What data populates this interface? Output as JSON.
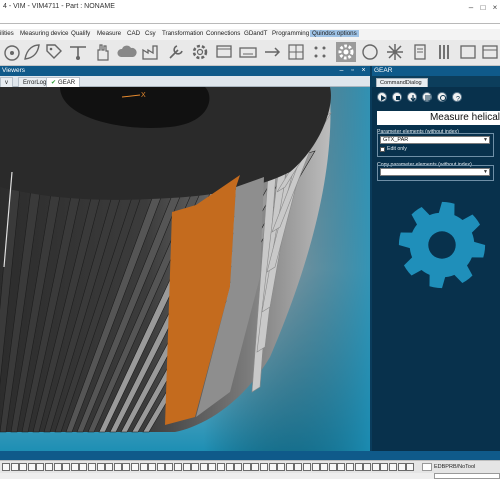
{
  "window": {
    "title": "4 - VIM - VIM4711 - Part : NONAME"
  },
  "menu": [
    {
      "label": "ilities",
      "active": false
    },
    {
      "label": "Measuring device",
      "active": false
    },
    {
      "label": "Qualify",
      "active": false
    },
    {
      "label": "Measure",
      "active": false
    },
    {
      "label": "CAD",
      "active": false
    },
    {
      "label": "Csy",
      "active": false
    },
    {
      "label": "Transformation",
      "active": false
    },
    {
      "label": "Connections",
      "active": false
    },
    {
      "label": "GDandT",
      "active": false
    },
    {
      "label": "Programming",
      "active": false
    },
    {
      "label": "Quindos options",
      "active": true
    }
  ],
  "viewer": {
    "header_label": "Viewers",
    "tabs": [
      {
        "label": "v",
        "active": false,
        "checked": false
      },
      {
        "label": "ErrorLog",
        "active": false,
        "checked": false
      },
      {
        "label": "GEAR",
        "active": true,
        "checked": true
      }
    ],
    "axis_label": "X"
  },
  "gear_panel": {
    "header_label": "GEAR",
    "command_tab": "CommandDialog",
    "measure_title": "Measure helical",
    "param_label": "Parameter elements (without index)",
    "param_value": "GTX_PAR",
    "edit_only_label": "Edit only",
    "copy_label": "Copy parameter elements (without index)",
    "copy_value": ""
  },
  "status": {
    "text": "EDBPRB/NoTool"
  },
  "colors": {
    "accent_blue": "#0f5a8a",
    "panel_bg": "#08314c",
    "gear_icon": "#1f8fba",
    "highlight_tooth": "#c46b1e"
  }
}
